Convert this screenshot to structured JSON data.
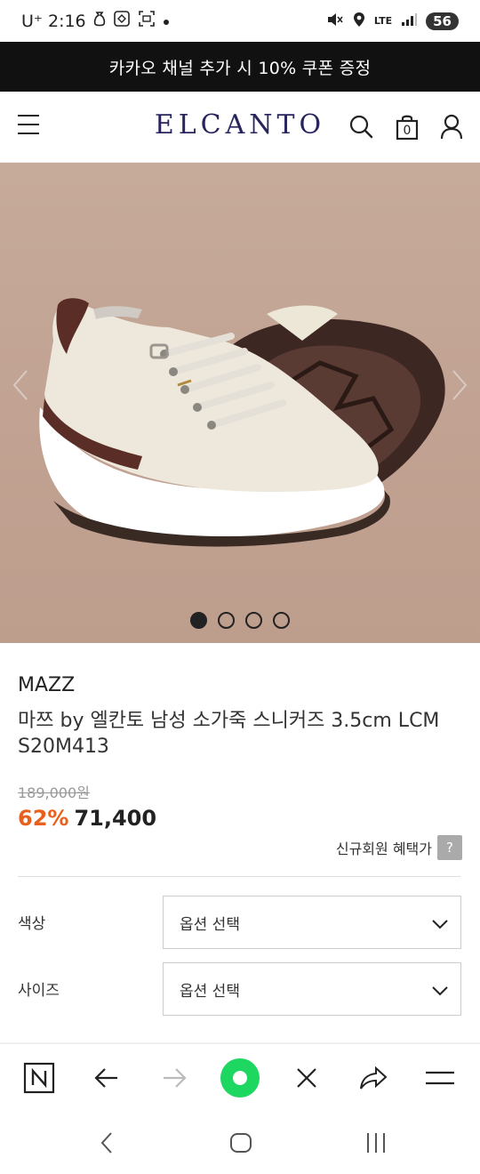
{
  "status_bar": {
    "carrier_time": "U⁺ 2:16",
    "icons_left": [
      "money-bag-icon",
      "gift-icon",
      "screen-scan-icon",
      "dot-icon"
    ],
    "network": "LTE",
    "battery": "56"
  },
  "promo_banner": {
    "text": "카카오 채널 추가 시 10% 쿠폰 증정"
  },
  "header": {
    "logo": "ELCANTO",
    "cart_count": "0"
  },
  "hero": {
    "slide_count": 4,
    "active_slide": 1
  },
  "product": {
    "brand": "MAZZ",
    "title": "마쯔 by 엘칸토 남성 소가죽 스니커즈 3.5cm LCM S20M413",
    "original_price": "189,000원",
    "discount": "62%",
    "sale_price": "71,400",
    "member_price_label": "신규회원 혜택가",
    "help_label": "?"
  },
  "options": [
    {
      "label": "색상",
      "value": "옵션 선택"
    },
    {
      "label": "사이즈",
      "value": "옵션 선택"
    }
  ],
  "colors": {
    "logo": "#28245e",
    "discount": "#e8601c",
    "browser_accent": "#1ed760"
  }
}
